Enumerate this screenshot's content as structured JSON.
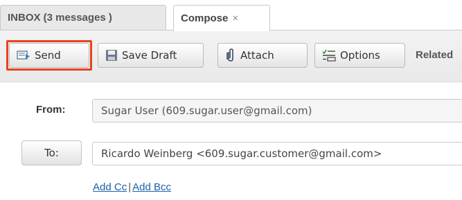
{
  "tabs": [
    {
      "label": "INBOX (3 messages )"
    },
    {
      "label": "Compose",
      "close": "×"
    }
  ],
  "toolbar": {
    "send_label": "Send",
    "save_draft_label": "Save Draft",
    "attach_label": "Attach",
    "options_label": "Options",
    "related_label": "Related",
    "highlight_color": "#e8421f"
  },
  "form": {
    "from_label": "From:",
    "from_value": "Sugar User (609.sugar.user@gmail.com)",
    "to_button_label": "To:",
    "to_value": "Ricardo Weinberg <609.sugar.customer@gmail.com>",
    "add_cc": "Add Cc",
    "separator": "|",
    "add_bcc": "Add Bcc"
  },
  "icons": [
    "send-icon",
    "save-disk-icon",
    "paperclip-icon",
    "options-list-icon",
    "close-icon"
  ]
}
